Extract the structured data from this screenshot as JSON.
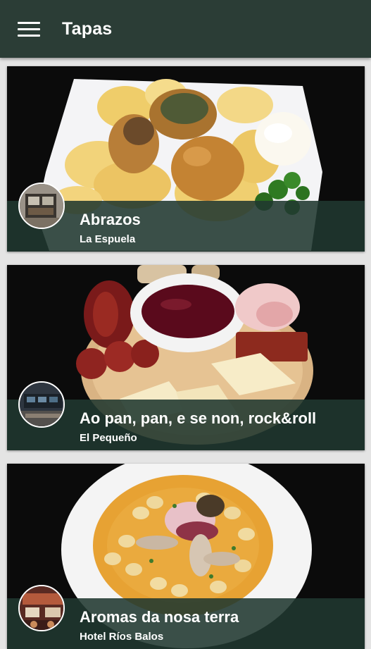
{
  "header": {
    "title": "Tapas",
    "menu_icon": "hamburger-menu-icon",
    "bar_color": "#2b3d36"
  },
  "cards": [
    {
      "name": "Abrazos",
      "place": "La Espuela"
    },
    {
      "name": "Ao pan, pan, e se non, rock&roll",
      "place": "El Pequeño"
    },
    {
      "name": "Aromas da nosa terra",
      "place": "Hotel Ríos Balos"
    }
  ]
}
